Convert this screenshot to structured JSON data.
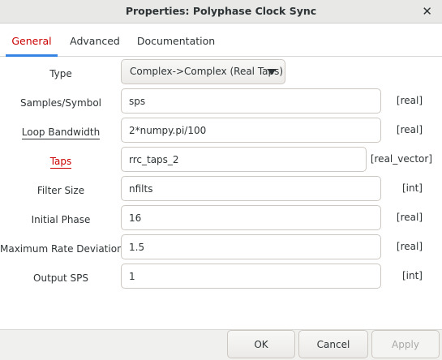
{
  "window": {
    "title": "Properties: Polyphase Clock Sync",
    "close_glyph": "✕"
  },
  "tabs": [
    {
      "label": "General",
      "active": true
    },
    {
      "label": "Advanced",
      "active": false
    },
    {
      "label": "Documentation",
      "active": false
    }
  ],
  "form": {
    "type": {
      "label": "Type",
      "value": "Complex->Complex (Real Taps)"
    },
    "sps": {
      "label": "Samples/Symbol",
      "value": "sps",
      "unit": "[real]"
    },
    "loop_bw": {
      "label": "Loop Bandwidth",
      "value": "2*numpy.pi/100",
      "unit": "[real]"
    },
    "taps": {
      "label": "Taps",
      "value": "rrc_taps_2",
      "unit": "[real_vector]"
    },
    "filter_size": {
      "label": "Filter Size",
      "value": "nfilts",
      "unit": "[int]"
    },
    "init_phase": {
      "label": "Initial Phase",
      "value": "16",
      "unit": "[real]"
    },
    "max_rate_dev": {
      "label": "Maximum Rate Deviation",
      "value": "1.5",
      "unit": "[real]"
    },
    "output_sps": {
      "label": "Output SPS",
      "value": "1",
      "unit": "[int]"
    }
  },
  "buttons": {
    "ok": "OK",
    "cancel": "Cancel",
    "apply": "Apply"
  },
  "colors": {
    "active_tab_text": "#cc0000",
    "active_tab_underline": "#3584e4",
    "error_label": "#cc0000",
    "disabled_text": "#a9aaa6"
  }
}
